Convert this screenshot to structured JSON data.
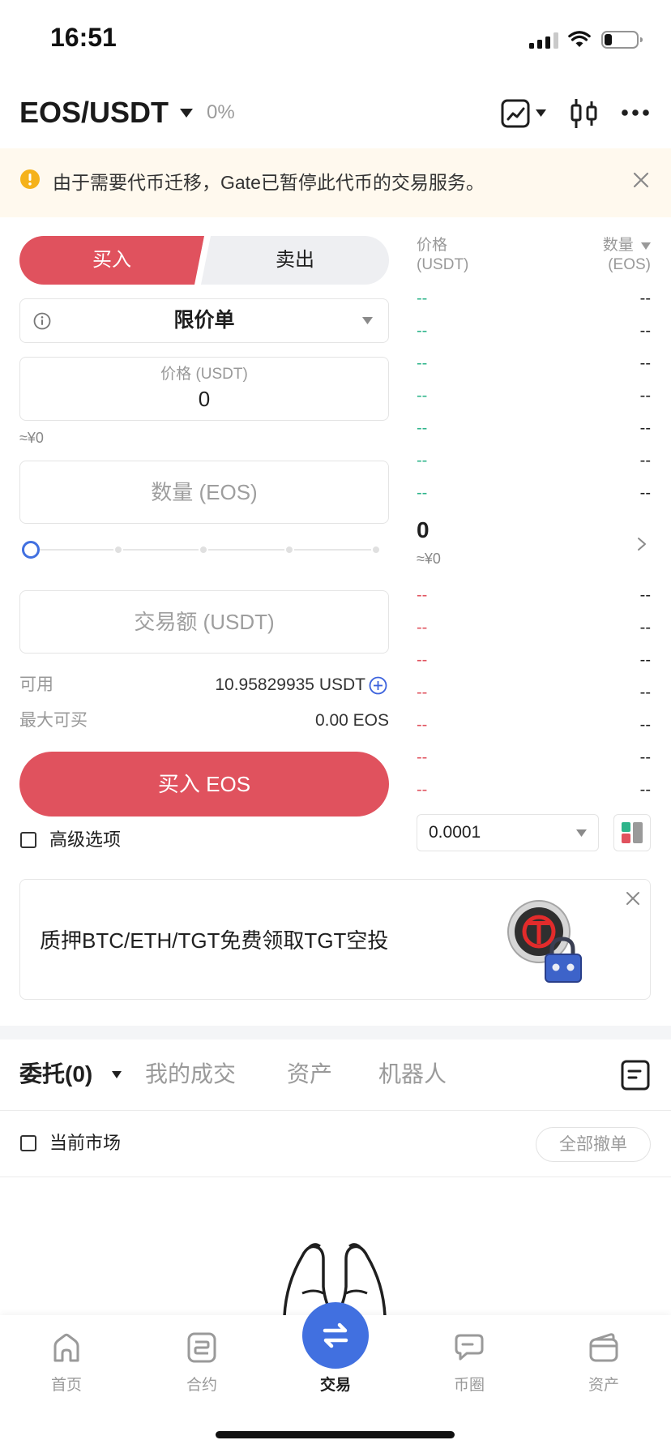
{
  "status_bar": {
    "time": "16:51"
  },
  "header": {
    "pair": "EOS/USDT",
    "change": "0%",
    "icons": [
      "pair-dropdown-icon",
      "chart-icon",
      "candlestick-icon",
      "more-icon"
    ]
  },
  "notice": {
    "icon": "warning-icon",
    "text": "由于需要代币迁移，Gate已暂停此代币的交易服务。"
  },
  "order_form": {
    "buy_tab": "买入",
    "sell_tab": "卖出",
    "active_side": "buy",
    "order_type": "限价单",
    "price_label": "价格 (USDT)",
    "price_value": "0",
    "price_cny": "≈¥0",
    "quantity_placeholder": "数量 (EOS)",
    "slider_percent": 0,
    "amount_placeholder": "交易额 (USDT)",
    "available_label": "可用",
    "available_value": "10.95829935 USDT",
    "max_buy_label": "最大可买",
    "max_buy_value": "0.00 EOS",
    "submit_label": "买入 EOS",
    "advanced_label": "高级选项",
    "advanced_checked": false
  },
  "order_book": {
    "price_header": "价格",
    "price_unit": "(USDT)",
    "qty_header": "数量",
    "qty_unit": "(EOS)",
    "asks": [
      {
        "price": "--",
        "qty": "--"
      },
      {
        "price": "--",
        "qty": "--"
      },
      {
        "price": "--",
        "qty": "--"
      },
      {
        "price": "--",
        "qty": "--"
      },
      {
        "price": "--",
        "qty": "--"
      },
      {
        "price": "--",
        "qty": "--"
      },
      {
        "price": "--",
        "qty": "--"
      }
    ],
    "last_price": "0",
    "last_price_cny": "≈¥0",
    "bids": [
      {
        "price": "--",
        "qty": "--"
      },
      {
        "price": "--",
        "qty": "--"
      },
      {
        "price": "--",
        "qty": "--"
      },
      {
        "price": "--",
        "qty": "--"
      },
      {
        "price": "--",
        "qty": "--"
      },
      {
        "price": "--",
        "qty": "--"
      },
      {
        "price": "--",
        "qty": "--"
      }
    ],
    "precision": "0.0001"
  },
  "promo": {
    "text": "质押BTC/ETH/TGT免费领取TGT空投"
  },
  "orders": {
    "tabs": [
      {
        "label": "委托(0)",
        "active": true
      },
      {
        "label": "我的成交",
        "active": false
      },
      {
        "label": "资产",
        "active": false
      },
      {
        "label": "机器人",
        "active": false
      }
    ],
    "filter_label": "当前市场",
    "filter_checked": false,
    "cancel_all": "全部撤单"
  },
  "bottom_nav": {
    "items": [
      {
        "label": "首页",
        "icon": "home-icon",
        "active": false
      },
      {
        "label": "合约",
        "icon": "contract-icon",
        "active": false
      },
      {
        "label": "交易",
        "icon": "trade-icon",
        "active": true
      },
      {
        "label": "币圈",
        "icon": "community-icon",
        "active": false
      },
      {
        "label": "资产",
        "icon": "wallet-icon",
        "active": false
      }
    ]
  },
  "colors": {
    "buy": "#e0525e",
    "ask": "#2db48a",
    "bid": "#e0525e",
    "accent": "#4170e0",
    "muted": "#999999"
  }
}
